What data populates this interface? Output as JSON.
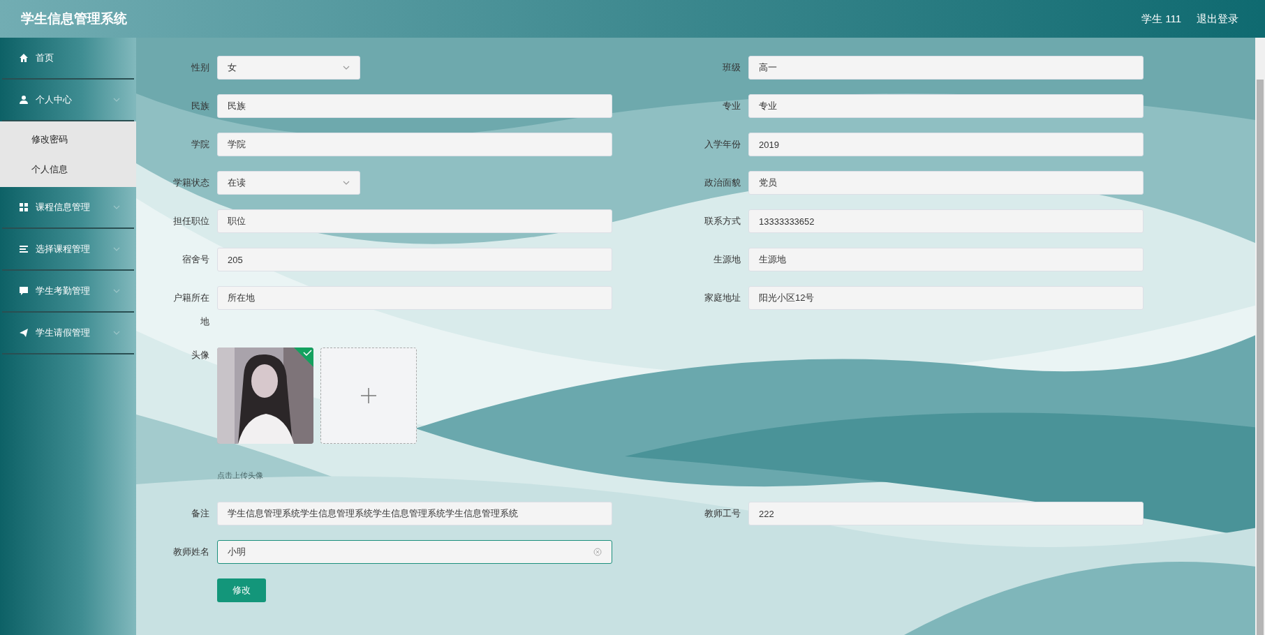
{
  "header": {
    "title": "学生信息管理系统",
    "user": "学生 111",
    "logout": "退出登录"
  },
  "sidebar": {
    "items": [
      {
        "label": "首页",
        "expandable": false
      },
      {
        "label": "个人中心",
        "expandable": true,
        "expanded": true,
        "children": [
          {
            "label": "修改密码"
          },
          {
            "label": "个人信息"
          }
        ]
      },
      {
        "label": "课程信息管理",
        "expandable": true
      },
      {
        "label": "选择课程管理",
        "expandable": true
      },
      {
        "label": "学生考勤管理",
        "expandable": true
      },
      {
        "label": "学生请假管理",
        "expandable": true
      }
    ]
  },
  "form": {
    "rows": [
      {
        "cells": [
          {
            "label": "性别",
            "kind": "select",
            "value": "女"
          },
          {
            "label": "班级",
            "kind": "input",
            "value": "高一"
          }
        ]
      },
      {
        "cells": [
          {
            "label": "民族",
            "kind": "input",
            "value": "民族"
          },
          {
            "label": "专业",
            "kind": "input",
            "value": "专业"
          }
        ]
      },
      {
        "cells": [
          {
            "label": "学院",
            "kind": "input",
            "value": "学院"
          },
          {
            "label": "入学年份",
            "kind": "input",
            "value": "2019"
          }
        ]
      },
      {
        "cells": [
          {
            "label": "学籍状态",
            "kind": "select",
            "value": "在读"
          },
          {
            "label": "政治面貌",
            "kind": "input",
            "value": "党员"
          }
        ]
      },
      {
        "cells": [
          {
            "label": "担任职位",
            "kind": "input",
            "value": "职位"
          },
          {
            "label": "联系方式",
            "kind": "input",
            "value": "13333333652"
          }
        ]
      },
      {
        "cells": [
          {
            "label": "宿舍号",
            "kind": "input",
            "value": "205"
          },
          {
            "label": "生源地",
            "kind": "input",
            "value": "生源地"
          }
        ]
      },
      {
        "cells": [
          {
            "label": "户籍所在地",
            "kind": "input",
            "value": "所在地"
          },
          {
            "label": "家庭地址",
            "kind": "input",
            "value": "阳光小区12号"
          }
        ]
      }
    ],
    "avatar": {
      "label": "头像",
      "uploaded": true,
      "hint": "点击上传头像"
    },
    "rows_after": [
      {
        "cells": [
          {
            "label": "备注",
            "kind": "input",
            "value": "学生信息管理系统学生信息管理系统学生信息管理系统学生信息管理系统"
          },
          {
            "label": "教师工号",
            "kind": "input",
            "value": "222"
          }
        ]
      },
      {
        "cells": [
          {
            "label": "教师姓名",
            "kind": "input",
            "value": "小明",
            "focused": true
          }
        ]
      }
    ],
    "submit": "修改"
  }
}
